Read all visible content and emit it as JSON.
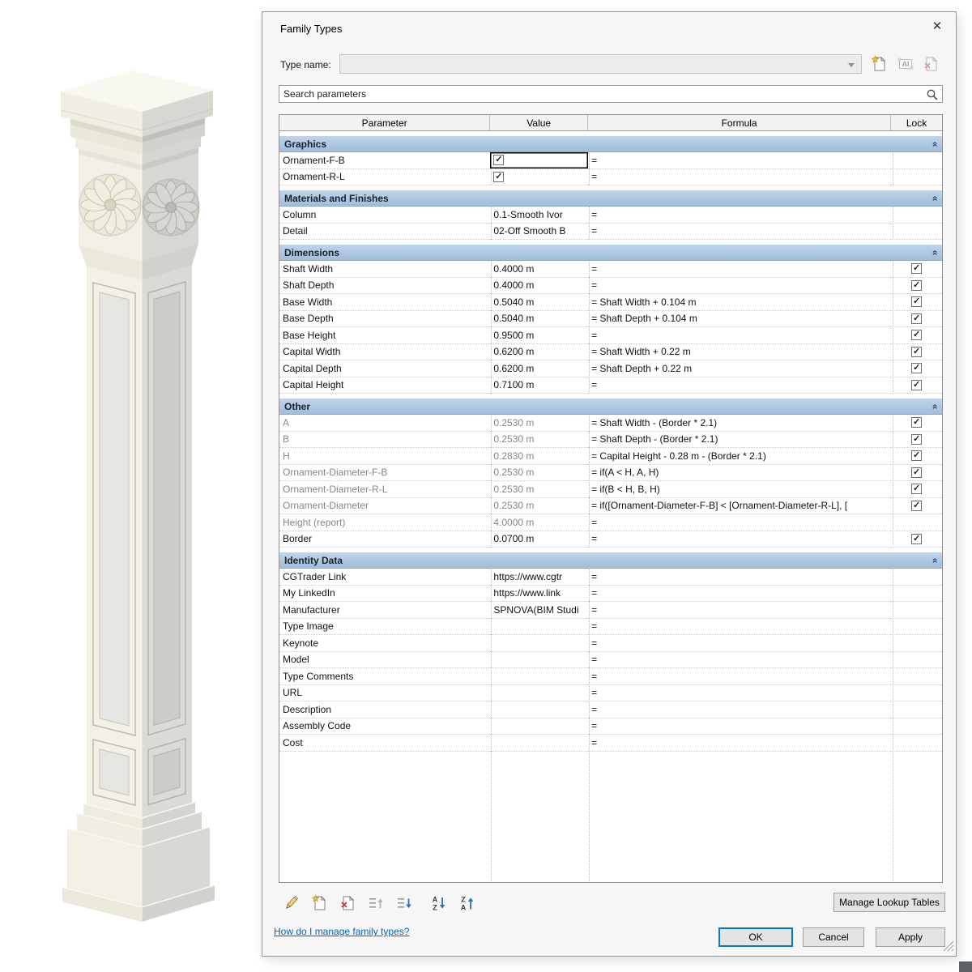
{
  "window": {
    "title": "Family Types"
  },
  "glyphs": {
    "close": "✕",
    "check": "✓",
    "section_collapse": "»"
  },
  "colors": {
    "section_header_blue": "#a9c4de",
    "link_blue": "#0563c1",
    "default_button_blue": "#0078d7",
    "star_gold": "#f2c03c",
    "delete_red": "#c23b3b",
    "arrow_blue": "#2e6fb8",
    "disabled_text": "#868686"
  },
  "preview": {
    "description": "3D rendering of a classical square column family with ornamental rosette capital, paneled shaft and molded base"
  },
  "type_name": {
    "label": "Type name:",
    "value": ""
  },
  "type_tools": [
    {
      "icon": "new-type-icon",
      "enabled": true
    },
    {
      "icon": "rename-type-icon",
      "enabled": false
    },
    {
      "icon": "delete-type-icon",
      "enabled": false
    }
  ],
  "search": {
    "placeholder": "Search parameters",
    "icon": "search-icon"
  },
  "table": {
    "columns": [
      "Parameter",
      "Value",
      "Formula",
      "Lock"
    ],
    "sections": [
      {
        "name": "Graphics",
        "rows": [
          {
            "param": "Ornament-F-B",
            "value_checkbox": true,
            "checked": true,
            "formula": "=",
            "selected": true
          },
          {
            "param": "Ornament-R-L",
            "value_checkbox": true,
            "checked": true,
            "formula": "="
          }
        ]
      },
      {
        "name": "Materials and Finishes",
        "rows": [
          {
            "param": "Column",
            "value": "0.1-Smooth Ivor",
            "formula": "="
          },
          {
            "param": "Detail",
            "value": "02-Off Smooth B",
            "formula": "="
          }
        ]
      },
      {
        "name": "Dimensions",
        "rows": [
          {
            "param": "Shaft Width",
            "value": "0.4000 m",
            "formula": "=",
            "lock": true
          },
          {
            "param": "Shaft Depth",
            "value": "0.4000 m",
            "formula": "=",
            "lock": true
          },
          {
            "param": "Base Width",
            "value": "0.5040 m",
            "formula": "= Shaft Width + 0.104 m",
            "lock": true
          },
          {
            "param": "Base Depth",
            "value": "0.5040 m",
            "formula": "= Shaft Depth + 0.104 m",
            "lock": true
          },
          {
            "param": "Base Height",
            "value": "0.9500 m",
            "formula": "=",
            "lock": true
          },
          {
            "param": "Capital Width",
            "value": "0.6200 m",
            "formula": "= Shaft Width + 0.22 m",
            "lock": true
          },
          {
            "param": "Capital Depth",
            "value": "0.6200 m",
            "formula": "= Shaft Depth + 0.22 m",
            "lock": true
          },
          {
            "param": "Capital Height",
            "value": "0.7100 m",
            "formula": "=",
            "lock": true
          }
        ]
      },
      {
        "name": "Other",
        "rows": [
          {
            "param": "A",
            "value": "0.2530 m",
            "formula": "= Shaft Width - (Border * 2.1)",
            "lock": true,
            "disabled": true
          },
          {
            "param": "B",
            "value": "0.2530 m",
            "formula": "= Shaft Depth - (Border * 2.1)",
            "lock": true,
            "disabled": true
          },
          {
            "param": "H",
            "value": "0.2830 m",
            "formula": "= Capital Height - 0.28 m - (Border * 2.1)",
            "lock": true,
            "disabled": true
          },
          {
            "param": "Ornament-Diameter-F-B",
            "value": "0.2530 m",
            "formula": "= if(A < H, A, H)",
            "lock": true,
            "disabled": true
          },
          {
            "param": "Ornament-Diameter-R-L",
            "value": "0.2530 m",
            "formula": "= if(B < H, B, H)",
            "lock": true,
            "disabled": true
          },
          {
            "param": "Ornament-Diameter",
            "value": "0.2530 m",
            "formula": "= if([Ornament-Diameter-F-B] < [Ornament-Diameter-R-L], [",
            "lock": true,
            "disabled": true
          },
          {
            "param": "Height (report)",
            "value": "4.0000 m",
            "formula": "=",
            "disabled": true
          },
          {
            "param": "Border",
            "value": "0.0700 m",
            "formula": "=",
            "lock": true
          }
        ]
      },
      {
        "name": "Identity Data",
        "rows": [
          {
            "param": "CGTrader Link",
            "value": "https://www.cgtr",
            "formula": "="
          },
          {
            "param": "My LinkedIn",
            "value": "https://www.link",
            "formula": "="
          },
          {
            "param": "Manufacturer",
            "value": "SPNOVA(BIM Studi",
            "formula": "="
          },
          {
            "param": "Type Image",
            "value": "",
            "formula": "="
          },
          {
            "param": "Keynote",
            "value": "",
            "formula": "="
          },
          {
            "param": "Model",
            "value": "",
            "formula": "="
          },
          {
            "param": "Type Comments",
            "value": "",
            "formula": "="
          },
          {
            "param": "URL",
            "value": "",
            "formula": "="
          },
          {
            "param": "Description",
            "value": "",
            "formula": "="
          },
          {
            "param": "Assembly Code",
            "value": "",
            "formula": "="
          },
          {
            "param": "Cost",
            "value": "",
            "formula": "="
          }
        ]
      }
    ]
  },
  "param_tools": [
    {
      "icon": "edit-parameter-icon",
      "enabled": true
    },
    {
      "icon": "new-parameter-icon",
      "enabled": true
    },
    {
      "icon": "delete-parameter-icon",
      "enabled": true
    },
    {
      "icon": "move-up-icon",
      "enabled": false
    },
    {
      "icon": "move-down-icon",
      "enabled": true
    },
    {
      "icon": "sort-ascending-icon",
      "enabled": true
    },
    {
      "icon": "sort-descending-icon",
      "enabled": true
    }
  ],
  "footer": {
    "manage_lookup_tables": "Manage Lookup Tables",
    "help_link": "How do I manage family types?",
    "ok": "OK",
    "cancel": "Cancel",
    "apply": "Apply"
  }
}
